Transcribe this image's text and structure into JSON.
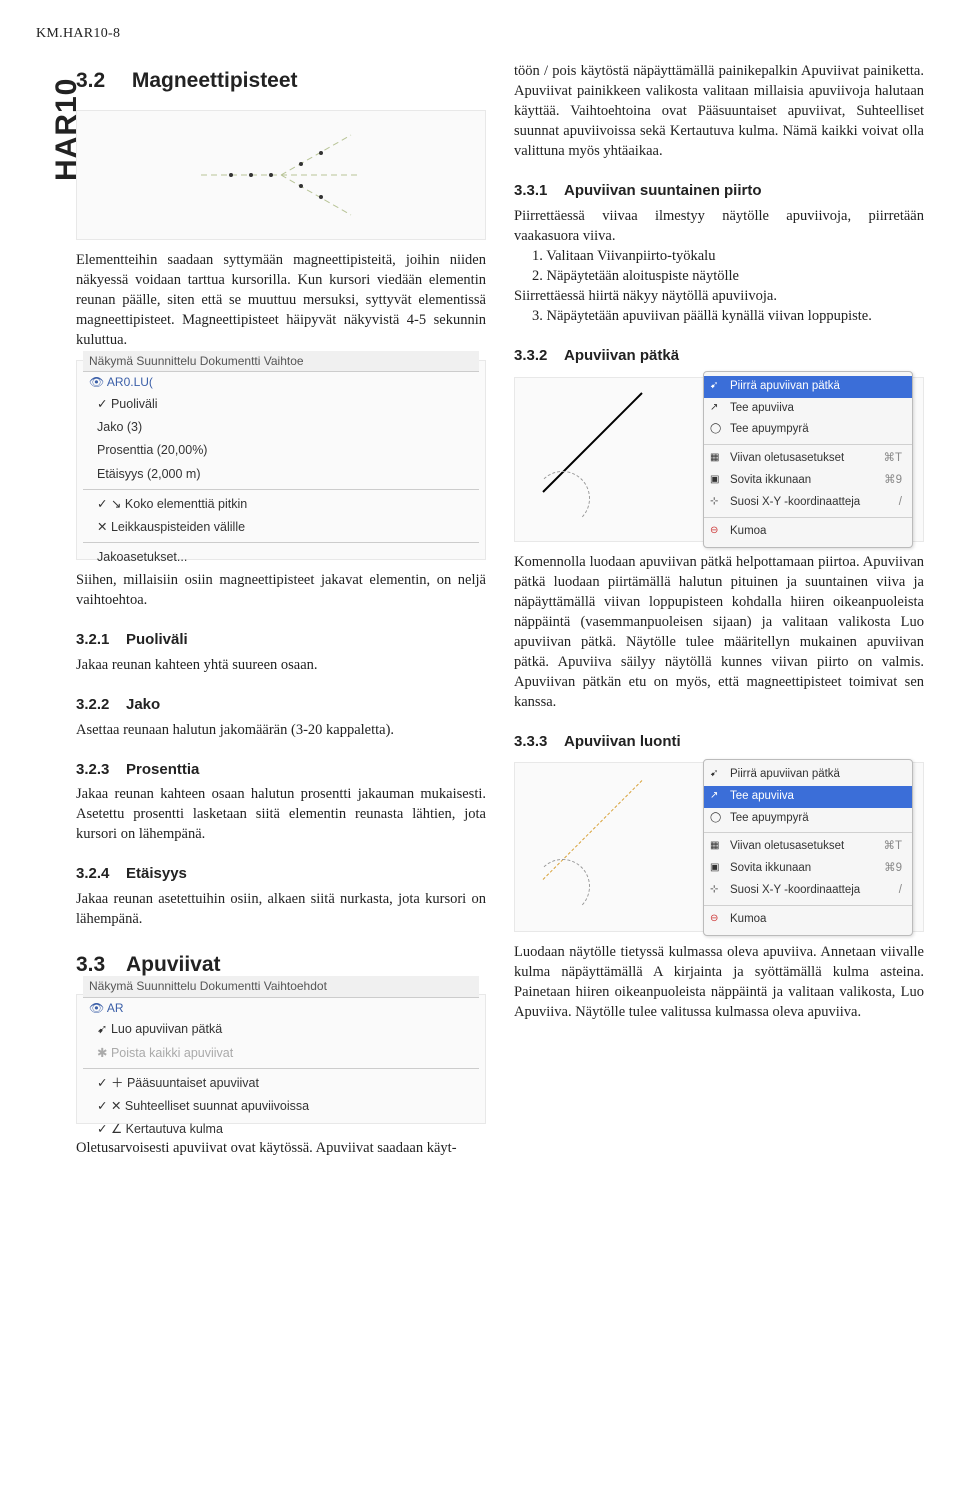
{
  "page_header": "KM.HAR10-8",
  "side_tab": "HAR10",
  "left": {
    "h32": {
      "num": "3.2",
      "title": "Magneettipisteet"
    },
    "p1": "Elementteihin saadaan syttymään magneettipisteitä, joihin niiden näkyessä voidaan tarttua kursorilla. Kun kursori viedään elementin reunan päälle, siten että se muuttuu mersuksi, syttyvät elementissä magneettipisteet. Magneettipisteet häipyvät näkyvistä 4-5 sekunnin kuluttua.",
    "menu1_strip": "Näkymä   Suunnittelu   Dokumentti   Vaihtoe",
    "menu1_aro": "AR0.LU(",
    "menu1_items": [
      "Puoliväli",
      "Jako (3)",
      "Prosenttia (20,00%)",
      "Etäisyys (2,000 m)",
      "Koko elementtiä pitkin",
      "Leikkauspisteiden välille",
      "Jakoasetukset..."
    ],
    "p2": "Siihen, millaisiin osiin magneettipisteet jakavat elementin, on neljä vaihtoehtoa.",
    "h321": {
      "num": "3.2.1",
      "title": "Puoliväli"
    },
    "p321": "Jakaa reunan kahteen yhtä suureen osaan.",
    "h322": {
      "num": "3.2.2",
      "title": "Jako"
    },
    "p322": "Asettaa reunaan halutun jakomäärän (3-20 kappaletta).",
    "h323": {
      "num": "3.2.3",
      "title": "Prosenttia"
    },
    "p323": "Jakaa reunan kahteen osaan halutun prosentti jakauman mukaisesti. Asetettu prosentti lasketaan siitä elementin reunasta lähtien, jota kursori on lähempänä.",
    "h324": {
      "num": "3.2.4",
      "title": "Etäisyys"
    },
    "p324": "Jakaa reunan asetettuihin osiin, alkaen siitä nurkasta, jota kursori on lähempänä.",
    "h33": {
      "num": "3.3",
      "title": "Apuviivat"
    },
    "menu2_strip": "Näkymä   Suunnittelu   Dokumentti   Vaihtoehdot",
    "menu2_aro": "AR",
    "menu2_items": [
      "Luo apuviivan pätkä",
      "Poista kaikki apuviivat",
      "Pääsuuntaiset apuviivat",
      "Suhteelliset suunnat apuviivoissa",
      "Kertautuva kulma"
    ],
    "p_bottom": "Oletusarvoisesti apuviivat ovat käytössä. Apuviivat saadaan käyt-"
  },
  "right": {
    "p_intro": "töön / pois käytöstä näpäyttämällä painikepalkin Apuviivat painiketta. Apuviivat painikkeen valikosta valitaan millaisia apuviivoja halutaan käyttää. Vaihtoehtoina ovat Pääsuuntaiset apuviivat, Suhteelliset suunnat apuviivoissa sekä Kertautuva kulma. Nämä kaikki voivat olla valittuna myös yhtäaikaa.",
    "h331": {
      "num": "3.3.1",
      "title": "Apuviivan suuntainen piirto"
    },
    "p331a": "Piirrettäessä viivaa ilmestyy näytölle apuviivoja, piirretään vaakasuora viiva.",
    "li1": "1. Valitaan Viivanpiirto-työkalu",
    "li2": "2. Näpäytetään aloituspiste näytölle",
    "p331b": "Siirrettäessä hiirtä näkyy näytöllä apuviivoja.",
    "li3": "3. Näpäytetään apuviivan päällä kynällä viivan loppupiste.",
    "h332": {
      "num": "3.3.2",
      "title": "Apuviivan pätkä"
    },
    "ctx1": {
      "hl": "Piirrä apuviivan pätkä",
      "items": [
        "Tee apuviiva",
        "Tee apuympyrä",
        "Viivan oletusasetukset",
        "Sovita ikkunaan",
        "Suosi X-Y -koordinaatteja",
        "Kumoa"
      ],
      "sc": [
        "",
        "",
        "⌘T",
        "⌘9",
        "/",
        ""
      ]
    },
    "p332": "Komennolla luodaan apuviivan pätkä helpottamaan piirtoa. Apuviivan pätkä luodaan piirtämällä halutun pituinen ja suuntainen viiva ja näpäyttämällä viivan loppupisteen kohdalla hiiren oikeanpuoleista näppäintä (vasemmanpuoleisen sijaan) ja valitaan valikosta Luo apuviivan pätkä. Näytölle tulee määritellyn mukainen apuviivan pätkä. Apuviiva säilyy näytöllä kunnes viivan piirto on valmis. Apuviivan pätkän etu on myös, että magneettipisteet toimivat sen kanssa.",
    "h333": {
      "num": "3.3.3",
      "title": "Apuviivan luonti"
    },
    "ctx2": {
      "items": [
        "Piirrä apuviivan pätkä",
        "Tee apuviiva",
        "Tee apuympyrä",
        "Viivan oletusasetukset",
        "Sovita ikkunaan",
        "Suosi X-Y -koordinaatteja",
        "Kumoa"
      ],
      "hl_idx": 1,
      "sc": [
        "",
        "",
        "",
        "⌘T",
        "⌘9",
        "/",
        ""
      ]
    },
    "p333": "Luodaan näytölle tietyssä kulmassa oleva apuviiva. Annetaan viivalle kulma näpäyttämällä A kirjainta ja syöttämällä kulma asteina. Painetaan hiiren oikeanpuoleista näppäintä ja valitaan valikosta, Luo Apuviiva. Näytölle tulee valitussa kulmassa oleva apuviiva."
  }
}
